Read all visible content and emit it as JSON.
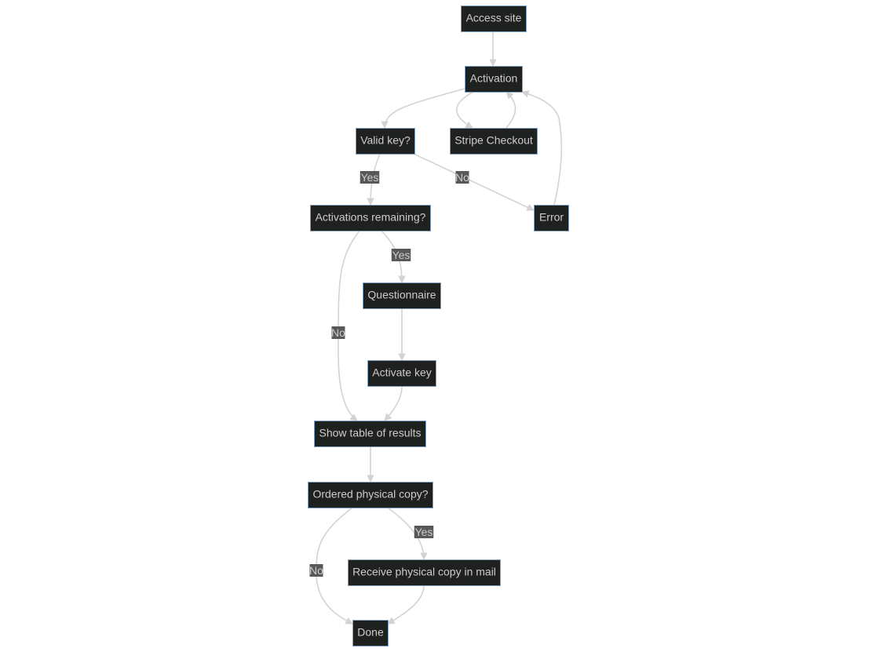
{
  "diagram": {
    "type": "flowchart",
    "colors": {
      "node_fill": "#1f2020",
      "node_border": "#81a1c1",
      "node_text": "#cccccc",
      "edge": "#d3d3d3",
      "edge_label_bg": "#585858",
      "edge_label_text": "#cccccc"
    },
    "nodes": [
      {
        "id": "access",
        "label": "Access site"
      },
      {
        "id": "activation",
        "label": "Activation"
      },
      {
        "id": "valid",
        "label": "Valid key?"
      },
      {
        "id": "stripe",
        "label": "Stripe Checkout"
      },
      {
        "id": "remaining",
        "label": "Activations remaining?"
      },
      {
        "id": "error",
        "label": "Error"
      },
      {
        "id": "questionnaire",
        "label": "Questionnaire"
      },
      {
        "id": "activate",
        "label": "Activate key"
      },
      {
        "id": "results",
        "label": "Show table of results"
      },
      {
        "id": "ordered",
        "label": "Ordered physical copy?"
      },
      {
        "id": "mail",
        "label": "Receive physical copy in mail"
      },
      {
        "id": "done",
        "label": "Done"
      }
    ],
    "edges": [
      {
        "from": "access",
        "to": "activation",
        "label": ""
      },
      {
        "from": "activation",
        "to": "valid",
        "label": ""
      },
      {
        "from": "activation",
        "to": "stripe",
        "label": ""
      },
      {
        "from": "stripe",
        "to": "activation",
        "label": ""
      },
      {
        "from": "error",
        "to": "activation",
        "label": ""
      },
      {
        "from": "valid",
        "to": "remaining",
        "label": "Yes"
      },
      {
        "from": "valid",
        "to": "error",
        "label": "No"
      },
      {
        "from": "remaining",
        "to": "questionnaire",
        "label": "Yes"
      },
      {
        "from": "remaining",
        "to": "results",
        "label": "No"
      },
      {
        "from": "questionnaire",
        "to": "activate",
        "label": ""
      },
      {
        "from": "activate",
        "to": "results",
        "label": ""
      },
      {
        "from": "results",
        "to": "ordered",
        "label": ""
      },
      {
        "from": "ordered",
        "to": "mail",
        "label": "Yes"
      },
      {
        "from": "ordered",
        "to": "done",
        "label": "No"
      },
      {
        "from": "mail",
        "to": "done",
        "label": ""
      }
    ]
  }
}
